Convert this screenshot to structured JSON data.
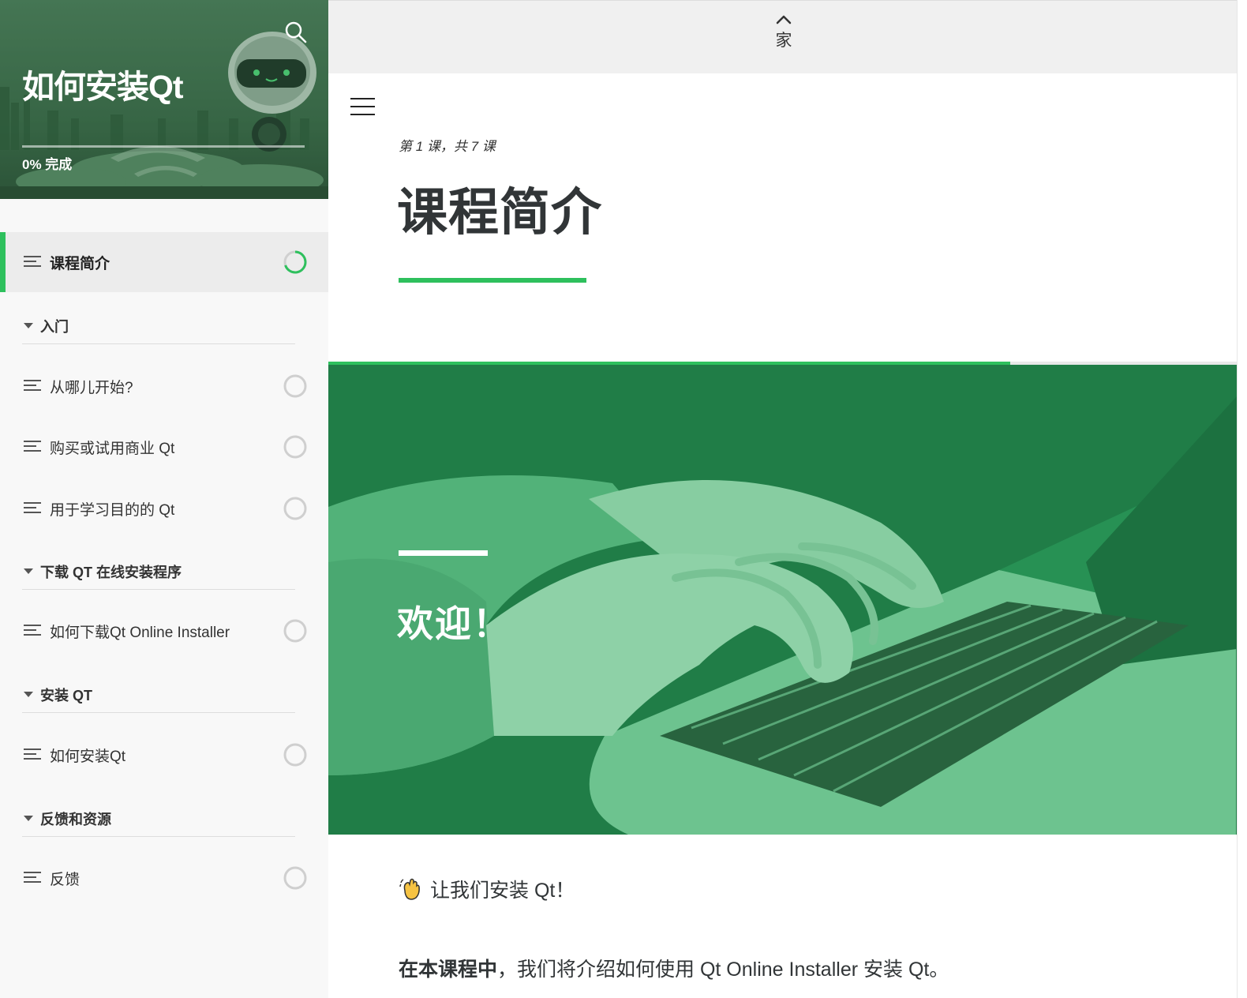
{
  "sidebar": {
    "course_title": "如何安装Qt",
    "progress_value": 0,
    "progress_label": "0% 完成",
    "search_icon": "search-icon",
    "active_lesson": {
      "label": "课程简介",
      "status": "in-progress"
    },
    "sections": [
      {
        "title": "入门",
        "lessons": [
          {
            "label": "从哪儿开始?",
            "status": "not-started"
          },
          {
            "label": "购买或试用商业 Qt",
            "status": "not-started"
          },
          {
            "label": "用于学习目的的 Qt",
            "status": "not-started"
          }
        ]
      },
      {
        "title": "下载 QT 在线安装程序",
        "lessons": [
          {
            "label": "如何下载Qt Online Installer",
            "status": "not-started"
          }
        ]
      },
      {
        "title": "安装 QT",
        "lessons": [
          {
            "label": "如何安装Qt",
            "status": "not-started"
          }
        ]
      },
      {
        "title": "反馈和资源",
        "lessons": [
          {
            "label": "反馈",
            "status": "not-started"
          }
        ]
      }
    ]
  },
  "topbar": {
    "home_label": "家",
    "home_icon": "chevron-up-icon"
  },
  "lesson": {
    "counter": "第 1 课，共 7 课",
    "title": "课程简介",
    "scroll_progress": 0.75,
    "hero_heading": "欢迎！",
    "wave_text": "让我们安装 Qt！",
    "intro_bold": "在本课程中",
    "intro_rest": "，我们将介绍如何使用 Qt Online Installer 安装 Qt。"
  },
  "colors": {
    "accent": "#2ec05d",
    "hero_tint": "#1f7a47",
    "text": "#313537",
    "sidebar_bg": "#f8f8f8",
    "topbar_bg": "#f0f0f0"
  }
}
